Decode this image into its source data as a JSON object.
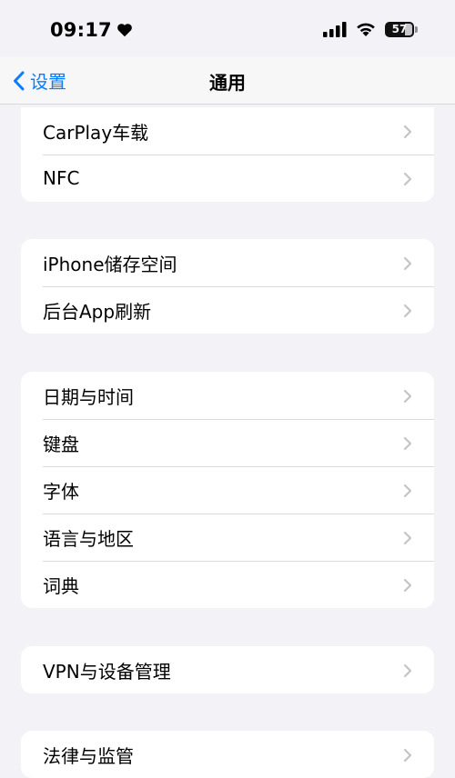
{
  "status_bar": {
    "time": "09:17",
    "battery": "57"
  },
  "nav": {
    "back_label": "设置",
    "title": "通用"
  },
  "groups": [
    {
      "rows": [
        "CarPlay车载",
        "NFC"
      ]
    },
    {
      "rows": [
        "iPhone储存空间",
        "后台App刷新"
      ]
    },
    {
      "rows": [
        "日期与时间",
        "键盘",
        "字体",
        "语言与地区",
        "词典"
      ]
    },
    {
      "rows": [
        "VPN与设备管理"
      ]
    },
    {
      "rows": [
        "法律与监管"
      ]
    }
  ],
  "colors": {
    "accent": "#0a7cff",
    "background": "#f2f2f7",
    "chevron": "#c4c4c7"
  }
}
